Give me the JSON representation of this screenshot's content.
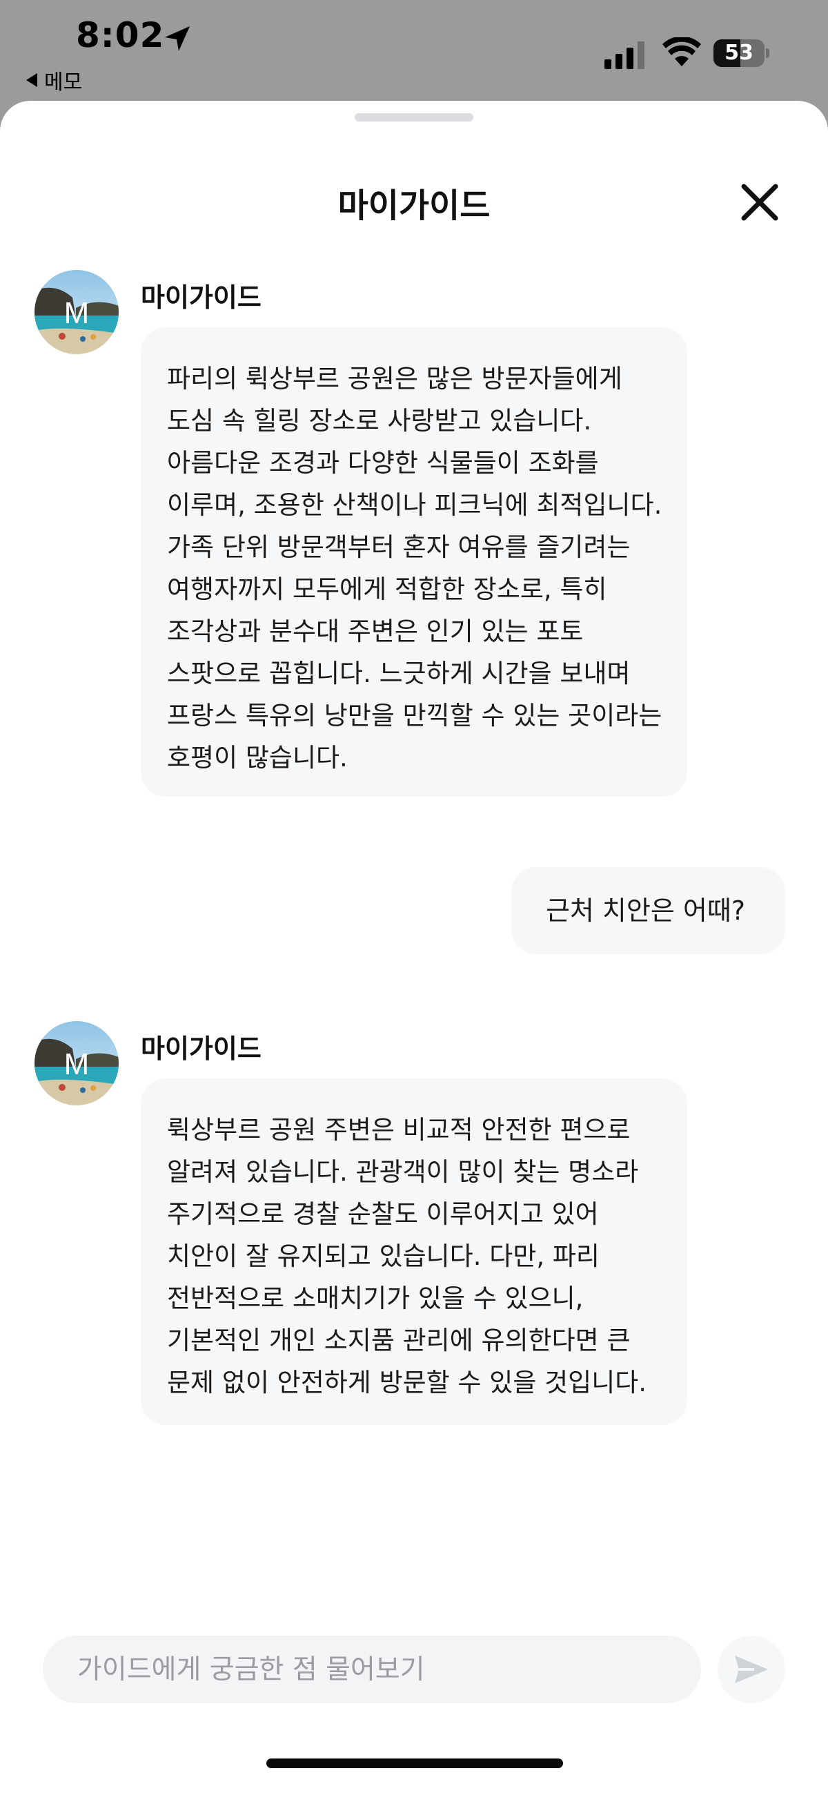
{
  "status_bar": {
    "time": "8:02",
    "back_label": "메모",
    "battery_level": "53",
    "battery_fraction": 0.53,
    "icons": [
      "location-arrow-icon",
      "cellular-signal-icon",
      "wifi-icon",
      "battery-icon"
    ]
  },
  "header": {
    "title": "마이가이드",
    "close_icon": "close-icon"
  },
  "messages": [
    {
      "role": "bot",
      "sender": "마이가이드",
      "avatar_letter": "M",
      "text": "파리의 뤽상부르 공원은 많은 방문자들에게 도심 속 힐링 장소로 사랑받고 있습니다. 아름다운 조경과 다양한 식물들이 조화를 이루며, 조용한 산책이나 피크닉에 최적입니다. 가족 단위 방문객부터 혼자 여유를 즐기려는 여행자까지 모두에게 적합한 장소로, 특히 조각상과 분수대 주변은 인기 있는 포토 스팟으로 꼽힙니다. 느긋하게 시간을 보내며 프랑스 특유의 낭만을 만끽할 수 있는 곳이라는 호평이 많습니다."
    },
    {
      "role": "user",
      "text": "근처 치안은 어때?"
    },
    {
      "role": "bot",
      "sender": "마이가이드",
      "avatar_letter": "M",
      "text": "뤽상부르 공원 주변은 비교적 안전한 편으로 알려져 있습니다. 관광객이 많이 찾는 명소라 주기적으로 경찰 순찰도 이루어지고 있어 치안이 잘 유지되고 있습니다. 다만, 파리 전반적으로 소매치기가 있을 수 있으니, 기본적인 개인 소지품 관리에 유의한다면 큰 문제 없이 안전하게 방문할 수 있을 것입니다."
    }
  ],
  "composer": {
    "placeholder": "가이드에게 궁금한 점 물어보기",
    "value": "",
    "send_icon": "send-icon"
  },
  "colors": {
    "status_bar_bg": "#9b9b9b",
    "sheet_bg": "#ffffff",
    "bubble_bg": "#f6f7f9",
    "input_bg": "#f3f4f6",
    "placeholder": "#9a9ca1",
    "text": "#1b1b1b"
  }
}
